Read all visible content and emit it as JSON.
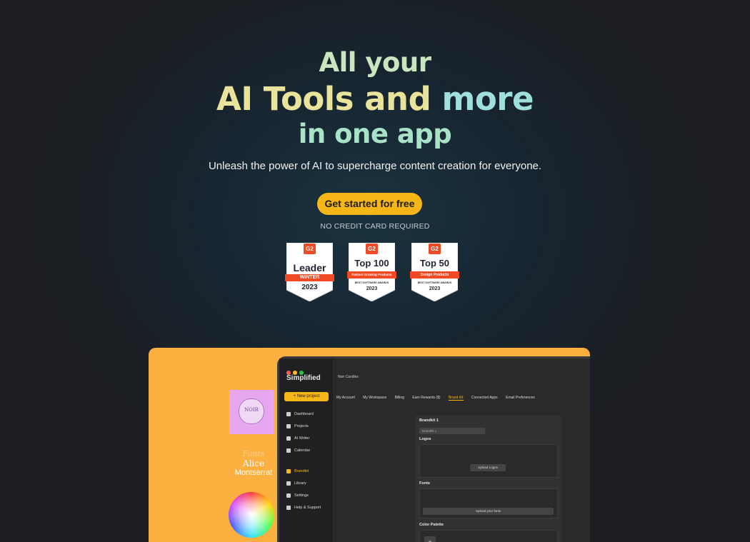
{
  "hero": {
    "line1": "All your",
    "line2_a": "AI Tools and",
    "line2_b": "more",
    "line3": "in one app",
    "subtitle": "Unleash the power of AI to supercharge content creation for everyone.",
    "cta_label": "Get started for free",
    "note": "NO CREDIT CARD REQUIRED"
  },
  "badges": [
    {
      "title": "Leader",
      "ribbon": "WINTER",
      "small": "",
      "year": "2023"
    },
    {
      "title": "Top 100",
      "ribbon": "Fastest Growing Products",
      "small": "BEST SOFTWARE AWARDS",
      "year": "2023"
    },
    {
      "title": "Top 50",
      "ribbon": "Design Products",
      "small": "BEST SOFTWARE AWARDS",
      "year": "2023"
    }
  ],
  "badge_logo": "G2",
  "preview": {
    "brand": "Simplified",
    "workspace": "Noir Candles",
    "new_project": "+ New project",
    "nav": [
      "Dashboard",
      "Projects",
      "AI Writer",
      "Calendar",
      "Brandkit",
      "Library",
      "Settings",
      "Help & Support"
    ],
    "tabs": [
      "My Account",
      "My Workspace",
      "Billing",
      "Earn Rewards ($)",
      "Brand Kit",
      "Connected Apps",
      "Email Preferences"
    ],
    "panel_title": "Brandkit 1",
    "panel_input": "Brandkit 1",
    "logos_label": "Logos",
    "upload_logos": "Upload Logos",
    "fonts_section": "Fonts",
    "upload_fonts": "Upload your fonts",
    "color_palette": "Color Palette",
    "card_text": "NOIR",
    "fonts_heading": "Fonts",
    "font1": "Alice",
    "font2": "Montserrat"
  },
  "colors": {
    "accent": "#f7b617",
    "preview_bg": "#fbb040",
    "g2_red": "#ef4a24"
  }
}
